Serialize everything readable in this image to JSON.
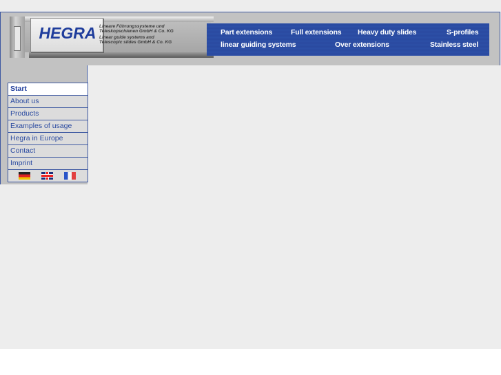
{
  "logo": {
    "brand": "HEGRA",
    "tagline_de_1": "Lineare Führungssysteme und",
    "tagline_de_2": "Teleskopschienen GmbH & Co. KG",
    "tagline_en_1": "Linear guide systems and",
    "tagline_en_2": "Telescopic slides GmbH & Co. KG"
  },
  "nav": {
    "row1": [
      "Part extensions",
      "Full extensions",
      "Heavy duty slides",
      "S-profiles"
    ],
    "row2": [
      "linear guiding systems",
      "Over extensions",
      "Stainless steel"
    ]
  },
  "menu": {
    "items": [
      {
        "label": "Start",
        "active": true
      },
      {
        "label": "About us"
      },
      {
        "label": "Products"
      },
      {
        "label": "Examples of usage"
      },
      {
        "label": "Hegra in Europe"
      },
      {
        "label": "Contact"
      },
      {
        "label": "Imprint"
      }
    ],
    "flags": [
      "german-flag-icon",
      "uk-flag-icon",
      "french-flag-icon"
    ]
  },
  "colors": {
    "brand_blue": "#2a4aa0",
    "header_gray": "#c2c2c2",
    "page_bg": "#ededed"
  }
}
